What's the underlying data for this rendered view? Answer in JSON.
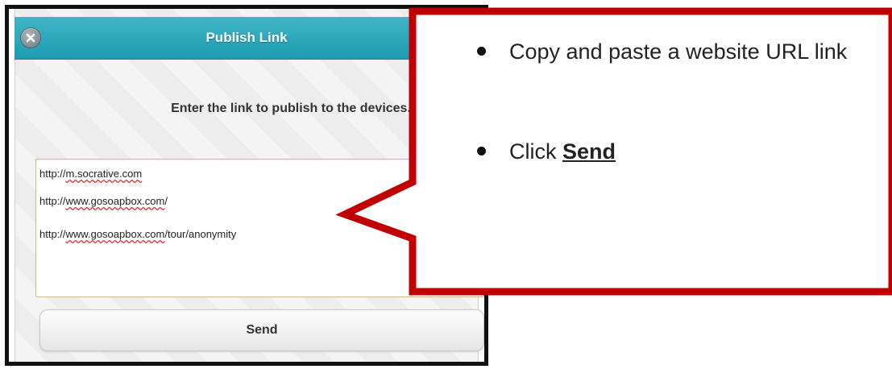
{
  "dialog": {
    "title": "Publish Link",
    "instruction": "Enter the link to publish to the devices.",
    "links": [
      {
        "prefix": "http://",
        "spell": "m.socrative.com",
        "suffix": ""
      },
      {
        "prefix": "http://",
        "spell": "www.gosoapbox.com",
        "suffix": "/"
      },
      {
        "prefix": "http://",
        "spell": "www.gosoapbox.com",
        "suffix": "/tour/anonymity"
      }
    ],
    "send_label": "Send"
  },
  "callout": {
    "border_color": "#c00000",
    "bullet1": "Copy and paste a website URL link",
    "bullet2_prefix": "Click ",
    "bullet2_bold": "Send"
  },
  "icons": {
    "close": "close-icon"
  },
  "colors": {
    "titlebar": "#29a7bb",
    "callout_border": "#c00000"
  }
}
